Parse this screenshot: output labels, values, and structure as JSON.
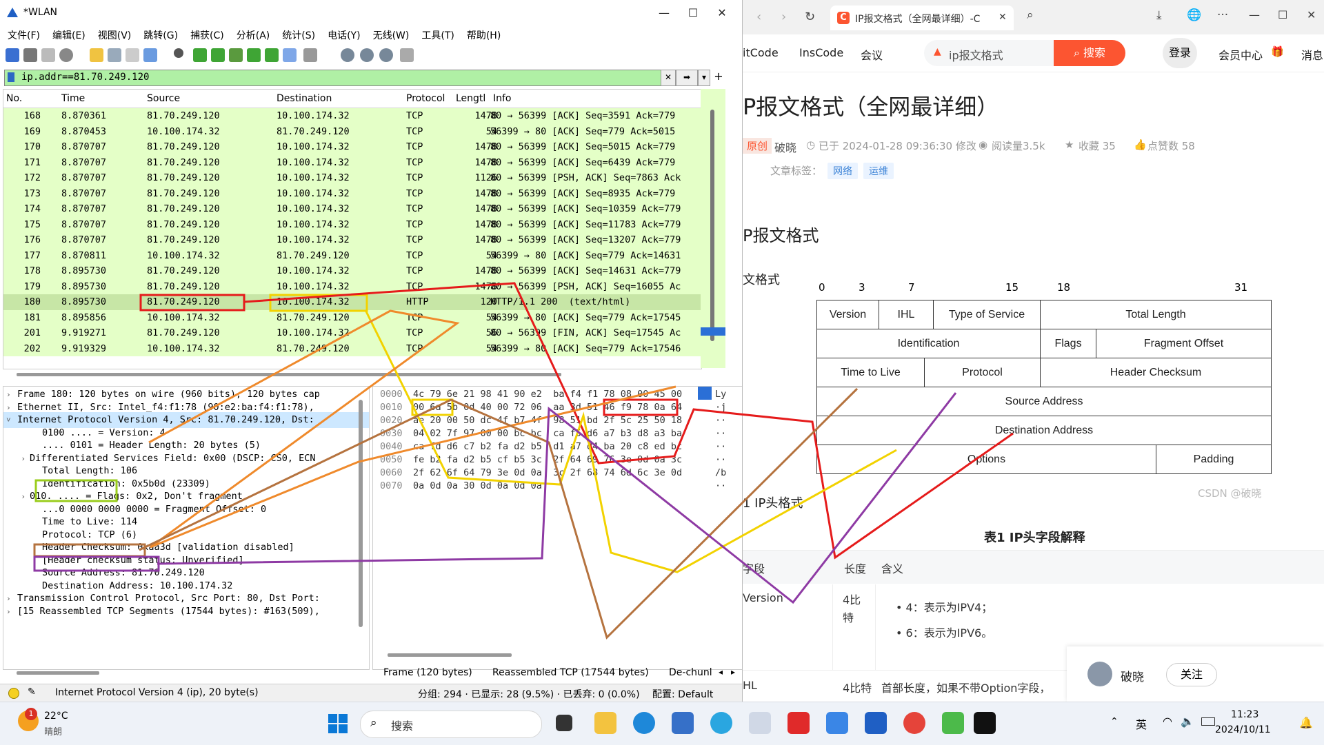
{
  "wireshark": {
    "title": "*WLAN",
    "menu": [
      "文件(F)",
      "编辑(E)",
      "视图(V)",
      "跳转(G)",
      "捕获(C)",
      "分析(A)",
      "统计(S)",
      "电话(Y)",
      "无线(W)",
      "工具(T)",
      "帮助(H)"
    ],
    "filter": "ip.addr==81.70.249.120",
    "columns": {
      "no": "No.",
      "time": "Time",
      "source": "Source",
      "destination": "Destination",
      "protocol": "Protocol",
      "length": "Lengtl",
      "info": "Info"
    },
    "packets": [
      {
        "no": "168",
        "time": "8.870361",
        "src": "81.70.249.120",
        "dst": "10.100.174.32",
        "proto": "TCP",
        "len": "1478",
        "info": "80 → 56399 [ACK] Seq=3591 Ack=779"
      },
      {
        "no": "169",
        "time": "8.870453",
        "src": "10.100.174.32",
        "dst": "81.70.249.120",
        "proto": "TCP",
        "len": "54",
        "info": "56399 → 80 [ACK] Seq=779 Ack=5015"
      },
      {
        "no": "170",
        "time": "8.870707",
        "src": "81.70.249.120",
        "dst": "10.100.174.32",
        "proto": "TCP",
        "len": "1478",
        "info": "80 → 56399 [ACK] Seq=5015 Ack=779"
      },
      {
        "no": "171",
        "time": "8.870707",
        "src": "81.70.249.120",
        "dst": "10.100.174.32",
        "proto": "TCP",
        "len": "1478",
        "info": "80 → 56399 [ACK] Seq=6439 Ack=779"
      },
      {
        "no": "172",
        "time": "8.870707",
        "src": "81.70.249.120",
        "dst": "10.100.174.32",
        "proto": "TCP",
        "len": "1126",
        "info": "80 → 56399 [PSH, ACK] Seq=7863 Ack"
      },
      {
        "no": "173",
        "time": "8.870707",
        "src": "81.70.249.120",
        "dst": "10.100.174.32",
        "proto": "TCP",
        "len": "1478",
        "info": "80 → 56399 [ACK] Seq=8935 Ack=779"
      },
      {
        "no": "174",
        "time": "8.870707",
        "src": "81.70.249.120",
        "dst": "10.100.174.32",
        "proto": "TCP",
        "len": "1478",
        "info": "80 → 56399 [ACK] Seq=10359 Ack=779"
      },
      {
        "no": "175",
        "time": "8.870707",
        "src": "81.70.249.120",
        "dst": "10.100.174.32",
        "proto": "TCP",
        "len": "1478",
        "info": "80 → 56399 [ACK] Seq=11783 Ack=779"
      },
      {
        "no": "176",
        "time": "8.870707",
        "src": "81.70.249.120",
        "dst": "10.100.174.32",
        "proto": "TCP",
        "len": "1478",
        "info": "80 → 56399 [ACK] Seq=13207 Ack=779"
      },
      {
        "no": "177",
        "time": "8.870811",
        "src": "10.100.174.32",
        "dst": "81.70.249.120",
        "proto": "TCP",
        "len": "54",
        "info": "56399 → 80 [ACK] Seq=779 Ack=14631"
      },
      {
        "no": "178",
        "time": "8.895730",
        "src": "81.70.249.120",
        "dst": "10.100.174.32",
        "proto": "TCP",
        "len": "1478",
        "info": "80 → 56399 [ACK] Seq=14631 Ack=779"
      },
      {
        "no": "179",
        "time": "8.895730",
        "src": "81.70.249.120",
        "dst": "10.100.174.32",
        "proto": "TCP",
        "len": "1478",
        "info": "80 → 56399 [PSH, ACK] Seq=16055 Ac"
      },
      {
        "no": "180",
        "time": "8.895730",
        "src": "81.70.249.120",
        "dst": "10.100.174.32",
        "proto": "HTTP",
        "len": "120",
        "info": "HTTP/1.1 200  (text/html)"
      },
      {
        "no": "181",
        "time": "8.895856",
        "src": "10.100.174.32",
        "dst": "81.70.249.120",
        "proto": "TCP",
        "len": "54",
        "info": "56399 → 80 [ACK] Seq=779 Ack=17545"
      },
      {
        "no": "201",
        "time": "9.919271",
        "src": "81.70.249.120",
        "dst": "10.100.174.32",
        "proto": "TCP",
        "len": "56",
        "info": "80 → 56399 [FIN, ACK] Seq=17545 Ac"
      },
      {
        "no": "202",
        "time": "9.919329",
        "src": "10.100.174.32",
        "dst": "81.70.249.120",
        "proto": "TCP",
        "len": "54",
        "info": "56399 → 80 [ACK] Seq=779 Ack=17546"
      }
    ],
    "details": [
      {
        "arrow": ">",
        "indent": 0,
        "text": "Frame 180: 120 bytes on wire (960 bits), 120 bytes cap"
      },
      {
        "arrow": ">",
        "indent": 0,
        "text": "Ethernet II, Src: Intel_f4:f1:78 (90:e2:ba:f4:f1:78),"
      },
      {
        "arrow": "v",
        "indent": 0,
        "text": "Internet Protocol Version 4, Src: 81.70.249.120, Dst:"
      },
      {
        "arrow": "",
        "indent": 2,
        "text": "0100 .... = Version: 4"
      },
      {
        "arrow": "",
        "indent": 2,
        "text": ".... 0101 = Header Length: 20 bytes (5)"
      },
      {
        "arrow": ">",
        "indent": 1,
        "text": "Differentiated Services Field: 0x00 (DSCP: CS0, ECN"
      },
      {
        "arrow": "",
        "indent": 2,
        "text": "Total Length: 106"
      },
      {
        "arrow": "",
        "indent": 2,
        "text": "Identification: 0x5b0d (23309)"
      },
      {
        "arrow": ">",
        "indent": 1,
        "text": "010. .... = Flags: 0x2, Don't fragment"
      },
      {
        "arrow": "",
        "indent": 2,
        "text": "...0 0000 0000 0000 = Fragment Offset: 0"
      },
      {
        "arrow": "",
        "indent": 2,
        "text": "Time to Live: 114"
      },
      {
        "arrow": "",
        "indent": 2,
        "text": "Protocol: TCP (6)"
      },
      {
        "arrow": "",
        "indent": 2,
        "text": "Header Checksum: 0xaa3d [validation disabled]"
      },
      {
        "arrow": "",
        "indent": 2,
        "text": "[Header checksum status: Unverified]"
      },
      {
        "arrow": "",
        "indent": 2,
        "text": "Source Address: 81.70.249.120"
      },
      {
        "arrow": "",
        "indent": 2,
        "text": "Destination Address: 10.100.174.32"
      },
      {
        "arrow": ">",
        "indent": 0,
        "text": "Transmission Control Protocol, Src Port: 80, Dst Port:"
      },
      {
        "arrow": ">",
        "indent": 0,
        "text": "[15 Reassembled TCP Segments (17544 bytes): #163(509),"
      }
    ],
    "bytes": [
      {
        "off": "0000",
        "hex": "4c 79 6e 21 98 41 90 e2  ba f4 f1 78 08 00 45 00",
        "ascii": "Ly"
      },
      {
        "off": "0010",
        "hex": "00 6a 5b 0d 40 00 72 06  aa 3d 51 46 f9 78 0a 64",
        "ascii": "·j"
      },
      {
        "off": "0020",
        "hex": "ae 20 00 50 dc 4f b7 4f  98 51 bd 2f 5c 25 50 18",
        "ascii": "··"
      },
      {
        "off": "0030",
        "hex": "04 02 7f 97 00 00 bc bc  ca f5 d6 a7 b3 d8 a3 ba",
        "ascii": "··"
      },
      {
        "off": "0040",
        "hex": "ca fd d6 c7 b2 fa d2 b5  d1 a7 d4 ba 20 c8 ed bc",
        "ascii": "··"
      },
      {
        "off": "0050",
        "hex": "fe b2 fa d2 b5 cf b5 3c  2f 64 69 76 3e 0d 0a 3c",
        "ascii": "··"
      },
      {
        "off": "0060",
        "hex": "2f 62 6f 64 79 3e 0d 0a  3c 2f 68 74 6d 6c 3e 0d",
        "ascii": "/b"
      },
      {
        "off": "0070",
        "hex": "0a 0d 0a 30 0d 0a 0d 0a",
        "ascii": "··"
      }
    ],
    "byte_tabs": [
      "Frame (120 bytes)",
      "Reassembled TCP (17544 bytes)",
      "De-chunl"
    ],
    "status": {
      "field": "Internet Protocol Version 4 (ip), 20 byte(s)",
      "counts": "分组: 294 · 已显示: 28 (9.5%) · 已丢弃: 0 (0.0%)",
      "profile": "配置: Default"
    }
  },
  "browser": {
    "tab_title": "IP报文格式（全网最详细）-C",
    "nav_links": [
      "itCode",
      "InsCode",
      "会议"
    ],
    "search_text": "ip报文格式",
    "search_button": "搜索",
    "login": "登录",
    "vip": "会员中心",
    "msg": "消息",
    "article_title": "P报文格式（全网最详细）",
    "badge": "原创",
    "author": "破晓",
    "updated": "已于 2024-01-28 09:36:30 修改",
    "reads": "阅读量3.5k",
    "favorites": "收藏 35",
    "likes": "点赞数 58",
    "tags_label": "文章标签：",
    "tags": [
      "网络",
      "运维"
    ],
    "h_ip": "P报文格式",
    "h_sub": "文格式",
    "bit_labels": [
      "0",
      "3",
      "7",
      "15",
      "18",
      "31"
    ],
    "fields": {
      "version": "Version",
      "ihl": "IHL",
      "tos": "Type of Service",
      "total_length": "Total Length",
      "identification": "Identification",
      "flags": "Flags",
      "frag_offset": "Fragment Offset",
      "ttl": "Time to Live",
      "protocol": "Protocol",
      "checksum": "Header Checksum",
      "src": "Source Address",
      "dst": "Destination Address",
      "options": "Options",
      "padding": "Padding"
    },
    "watermark": "CSDN @破晓",
    "fig_caption": "1 IP头格式",
    "table_caption": "表1 IP头字段解释",
    "table_head": [
      "字段",
      "长度",
      "含义"
    ],
    "row1": {
      "field": "Version",
      "len": "4比特",
      "items": [
        "4：表示为IPV4；",
        "6：表示为IPV6。"
      ]
    },
    "row2": {
      "field": "HL",
      "len": "4比特",
      "text": "首部长度，如果不带Option字段，"
    },
    "follow_name": "破晓",
    "follow_btn": "关注"
  },
  "taskbar": {
    "weather_temp": "22°C",
    "weather_desc": "晴朗",
    "search": "搜索",
    "ime": "英",
    "time": "11:23",
    "date": "2024/10/11"
  }
}
